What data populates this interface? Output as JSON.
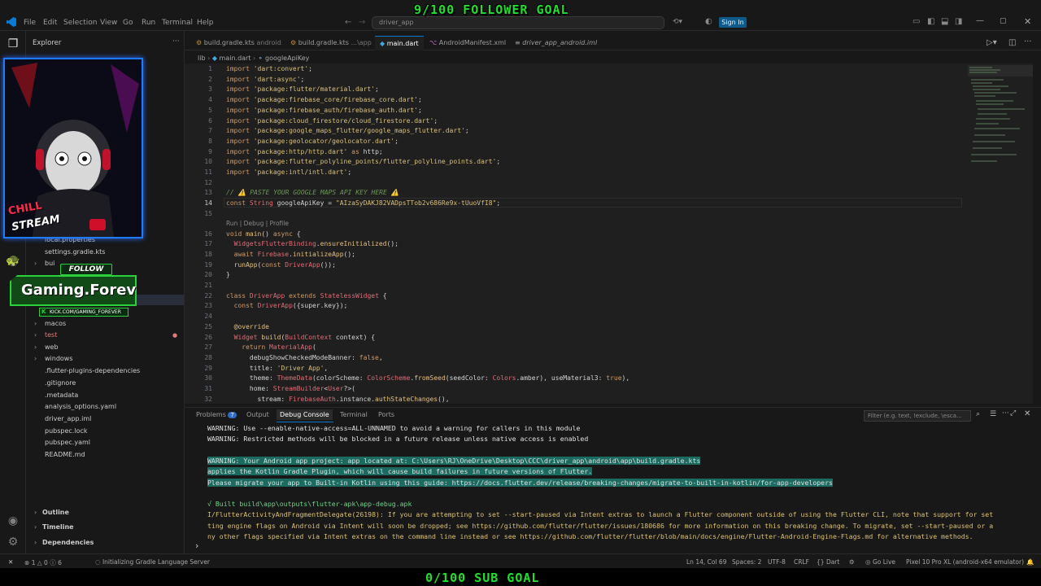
{
  "title_bar": {
    "menus": [
      "File",
      "Edit",
      "Selection",
      "View",
      "Go",
      "Run",
      "Terminal",
      "Help"
    ],
    "search_text": "driver_app",
    "sign_in_label": "Sign In"
  },
  "stream_overlay": {
    "follower_goal": "9/100 FOLLOWER GOAL",
    "sub_goal": "0/100 SUB GOAL",
    "follow_label": "FOLLOW",
    "channel_name": "Gaming.Foreve",
    "channel_url": "KICK.COM/GAMING_FOREVER",
    "webcam_caption_1": "CHILL",
    "webcam_caption_2": "STREAM"
  },
  "sidebar": {
    "header": "Explorer",
    "items": [
      {
        "label": "local.properties",
        "chevron": ""
      },
      {
        "label": "settings.gradle.kts",
        "chevron": ""
      },
      {
        "label": "bui",
        "chevron": "›"
      },
      {
        "label": "macos",
        "chevron": "›"
      },
      {
        "label": "test",
        "chevron": "›",
        "color": "#e07a7a"
      },
      {
        "label": "web",
        "chevron": "›"
      },
      {
        "label": "windows",
        "chevron": "›"
      },
      {
        "label": ".flutter-plugins-dependencies",
        "chevron": ""
      },
      {
        "label": ".gitignore",
        "chevron": ""
      },
      {
        "label": ".metadata",
        "chevron": ""
      },
      {
        "label": "analysis_options.yaml",
        "chevron": ""
      },
      {
        "label": "driver_app.iml",
        "chevron": ""
      },
      {
        "label": "pubspec.lock",
        "chevron": ""
      },
      {
        "label": "pubspec.yaml",
        "chevron": ""
      },
      {
        "label": "README.md",
        "chevron": ""
      }
    ],
    "sections": [
      "Outline",
      "Timeline",
      "Dependencies"
    ]
  },
  "tabs": [
    {
      "label": "build.gradle.kts",
      "sub": "android"
    },
    {
      "label": "build.gradle.kts",
      "sub": "...\\app"
    },
    {
      "label": "main.dart",
      "sub": ""
    },
    {
      "label": "AndroidManifest.xml",
      "sub": ""
    },
    {
      "label": "driver_app_android.iml",
      "sub": ""
    }
  ],
  "breadcrumb": {
    "a": "lib",
    "b": "main.dart",
    "c": "googleApiKey"
  },
  "code_lens": "Run | Debug | Profile",
  "code_lines": [
    {
      "n": "1",
      "t": "import 'dart:convert';"
    },
    {
      "n": "2",
      "t": "import 'dart:async';"
    },
    {
      "n": "3",
      "t": "import 'package:flutter/material.dart';"
    },
    {
      "n": "4",
      "t": "import 'package:firebase_core/firebase_core.dart';"
    },
    {
      "n": "5",
      "t": "import 'package:firebase_auth/firebase_auth.dart';"
    },
    {
      "n": "6",
      "t": "import 'package:cloud_firestore/cloud_firestore.dart';"
    },
    {
      "n": "7",
      "t": "import 'package:google_maps_flutter/google_maps_flutter.dart';"
    },
    {
      "n": "8",
      "t": "import 'package:geolocator/geolocator.dart';"
    },
    {
      "n": "9",
      "t": "import 'package:http/http.dart' as http;"
    },
    {
      "n": "10",
      "t": "import 'package:flutter_polyline_points/flutter_polyline_points.dart';"
    },
    {
      "n": "11",
      "t": "import 'package:intl/intl.dart';"
    },
    {
      "n": "12",
      "t": ""
    },
    {
      "n": "13",
      "t": "// ⚠️ PASTE YOUR GOOGLE MAPS API KEY HERE ⚠️"
    },
    {
      "n": "14",
      "t": "const String googleApiKey = \"AIzaSyDAKJ82VADpsTTob2v686Re9x-tUuoVfI8\";"
    },
    {
      "n": "15",
      "t": ""
    },
    {
      "n": "16",
      "t": "void main() async {"
    },
    {
      "n": "17",
      "t": "  WidgetsFlutterBinding.ensureInitialized();"
    },
    {
      "n": "18",
      "t": "  await Firebase.initializeApp();"
    },
    {
      "n": "19",
      "t": "  runApp(const DriverApp());"
    },
    {
      "n": "20",
      "t": "}"
    },
    {
      "n": "21",
      "t": ""
    },
    {
      "n": "22",
      "t": "class DriverApp extends StatelessWidget {"
    },
    {
      "n": "23",
      "t": "  const DriverApp({super.key});"
    },
    {
      "n": "24",
      "t": ""
    },
    {
      "n": "25",
      "t": "  @override"
    },
    {
      "n": "26",
      "t": "  Widget build(BuildContext context) {"
    },
    {
      "n": "27",
      "t": "    return MaterialApp("
    },
    {
      "n": "28",
      "t": "      debugShowCheckedModeBanner: false,"
    },
    {
      "n": "29",
      "t": "      title: 'Driver App',"
    },
    {
      "n": "30",
      "t": "      theme: ThemeData(colorScheme: ColorScheme.fromSeed(seedColor: Colors.amber), useMaterial3: true),"
    },
    {
      "n": "31",
      "t": "      home: StreamBuilder<User?>("
    },
    {
      "n": "32",
      "t": "        stream: FirebaseAuth.instance.authStateChanges(),"
    }
  ],
  "panel": {
    "tabs": [
      "Problems",
      "Output",
      "Debug Console",
      "Terminal",
      "Ports"
    ],
    "problems_count": "7",
    "filter_placeholder": "Filter (e.g. text, !exclude, \\esca...",
    "lines": [
      "WARNING: Use --enable-native-access=ALL-UNNAMED to avoid a warning for callers in this module",
      "WARNING: Restricted methods will be blocked in a future release unless native access is enabled",
      "",
      "WARNING: Your Android app project: app located at: C:\\Users\\RJ\\OneDrive\\Desktop\\CCC\\driver_app\\android\\app\\build.gradle.kts",
      "applies the Kotlin Gradle Plugin, which will cause build failures in future versions of Flutter.",
      "Please migrate your app to Built-in Kotlin using this guide: https://docs.flutter.dev/release/breaking-changes/migrate-to-built-in-kotlin/for-app-developers",
      "",
      "√ Built build\\app\\outputs\\flutter-apk\\app-debug.apk",
      "I/FlutterActivityAndFragmentDelegate(26198): If you are attempting to set --start-paused via Intent extras to launch a Flutter component outside of using the Flutter CLI, note that support for set",
      "ting engine flags on Android via Intent will soon be dropped; see https://github.com/flutter/flutter/issues/180686 for more information on this breaking change. To migrate, set --start-paused or a",
      "ny other flags specified via Intent extras on the command line instead or see https://github.com/flutter/flutter/blob/main/docs/engine/Flutter-Android-Engine-Flags.md for alternative methods."
    ],
    "prompt": "›"
  },
  "status_bar": {
    "errors": "1",
    "warnings": "0",
    "infos": "6",
    "task": "Initializing Gradle Language Server",
    "position": "Ln 14, Col 69",
    "spaces": "Spaces: 2",
    "encoding": "UTF-8",
    "eol": "CRLF",
    "language": "Dart",
    "go_live": "Go Live",
    "device": "Pixel 10 Pro XL (android-x64 emulator)"
  },
  "colors": {
    "accent": "#0078d4",
    "goal_green": "#1fe12b",
    "console_highlight": "#1b6b60"
  }
}
